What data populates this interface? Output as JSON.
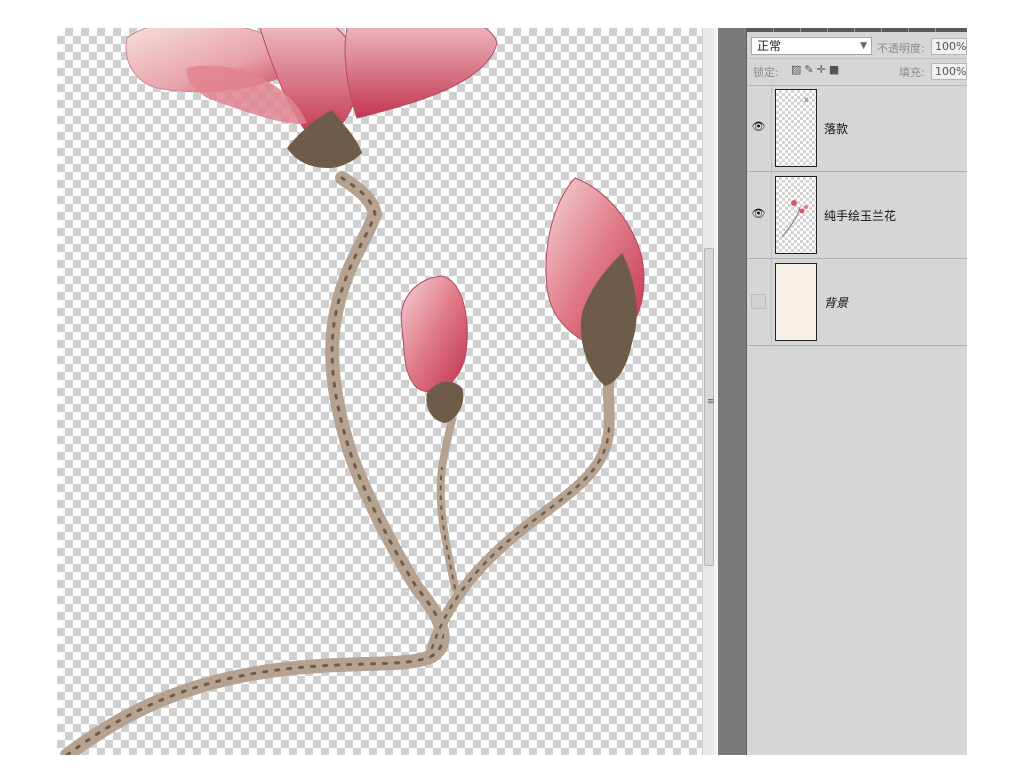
{
  "canvas": {
    "content": "magnolia-illustration",
    "transparency": "checkerboard"
  },
  "layers_panel": {
    "blend_mode": "正常",
    "opacity_label": "不透明度:",
    "opacity_value": "100%",
    "lock_label": "锁定:",
    "fill_label": "填充:",
    "fill_value": "100%",
    "layers": [
      {
        "name": "落款",
        "visible": true
      },
      {
        "name": "纯手绘玉兰花",
        "visible": true
      },
      {
        "name": "背景",
        "visible": false
      }
    ]
  },
  "colors": {
    "panel_bg": "#d6d6d6",
    "dark_bar": "#7a7a7a",
    "petal_pink": "#d9556a",
    "branch": "#b9a694",
    "calyx": "#6e5c48"
  },
  "icons": [
    "eye-icon",
    "lock-transparent-icon",
    "lock-brush-icon",
    "lock-move-icon",
    "lock-all-icon",
    "dropdown-arrow-icon"
  ]
}
